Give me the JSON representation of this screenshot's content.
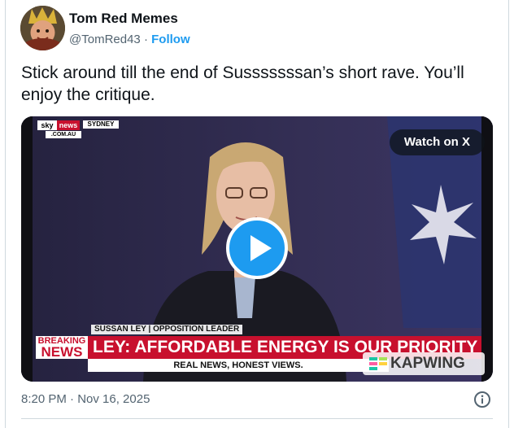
{
  "author": {
    "display_name": "Tom Red Memes",
    "handle": "@TomRed43",
    "separator": "·",
    "follow_label": "Follow"
  },
  "tweet": {
    "text": "Stick around till the end of Susssssssan’s short rave. You’ll enjoy the critique."
  },
  "media": {
    "watch_label": "Watch on X",
    "broadcast": {
      "logo_sky": "sky",
      "logo_news": "news",
      "logo_domain": ".COM.AU",
      "location": "SYDNEY",
      "name_strap": "SUSSAN LEY | OPPOSITION LEADER",
      "breaking_line1": "BREAKING",
      "breaking_line2": "NEWS",
      "headline": "LEY: AFFORDABLE ENERGY IS OUR PRIORITY",
      "ticker": "REAL NEWS, HONEST VIEWS.",
      "watermark": "KAPWING"
    }
  },
  "footer": {
    "timestamp": "8:20 PM · Nov 16, 2025"
  },
  "icons": {
    "play": "play-icon",
    "info": "info-icon",
    "avatar": "avatar-image"
  },
  "colors": {
    "accent": "#1d9bf0",
    "text": "#0f1419",
    "muted": "#536471",
    "breaking_red": "#c8102e"
  }
}
